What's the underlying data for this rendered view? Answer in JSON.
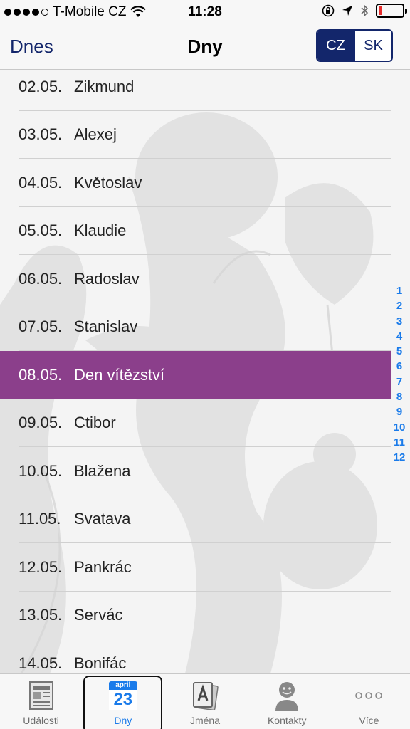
{
  "status_bar": {
    "carrier": "T-Mobile CZ",
    "time": "11:28",
    "battery_level": 0.15
  },
  "nav": {
    "left_label": "Dnes",
    "title": "Dny",
    "segments": [
      "CZ",
      "SK"
    ],
    "active_segment": "CZ"
  },
  "list": {
    "rows": [
      {
        "date": "02.05.",
        "name": "Zikmund"
      },
      {
        "date": "03.05.",
        "name": "Alexej"
      },
      {
        "date": "04.05.",
        "name": "Květoslav"
      },
      {
        "date": "05.05.",
        "name": "Klaudie"
      },
      {
        "date": "06.05.",
        "name": "Radoslav"
      },
      {
        "date": "07.05.",
        "name": "Stanislav"
      },
      {
        "date": "08.05.",
        "name": "Den vítězství"
      },
      {
        "date": "09.05.",
        "name": "Ctibor"
      },
      {
        "date": "10.05.",
        "name": "Blažena"
      },
      {
        "date": "11.05.",
        "name": "Svatava"
      },
      {
        "date": "12.05.",
        "name": "Pankrác"
      },
      {
        "date": "13.05.",
        "name": "Servác"
      },
      {
        "date": "14.05.",
        "name": "Bonifác"
      }
    ],
    "highlight_color": "#8b3f8b"
  },
  "index": [
    "1",
    "2",
    "3",
    "4",
    "5",
    "6",
    "7",
    "8",
    "9",
    "10",
    "11",
    "12"
  ],
  "tabs": [
    {
      "label": "Události",
      "icon": "newspaper-icon"
    },
    {
      "label": "Dny",
      "icon": "calendar-icon",
      "cal_month": "april",
      "cal_day": "23"
    },
    {
      "label": "Jména",
      "icon": "name-cards-icon"
    },
    {
      "label": "Kontakty",
      "icon": "person-icon"
    },
    {
      "label": "Více",
      "icon": "more-icon"
    }
  ],
  "colors": {
    "accent": "#1a7bea",
    "nav_blue": "#13266b"
  }
}
